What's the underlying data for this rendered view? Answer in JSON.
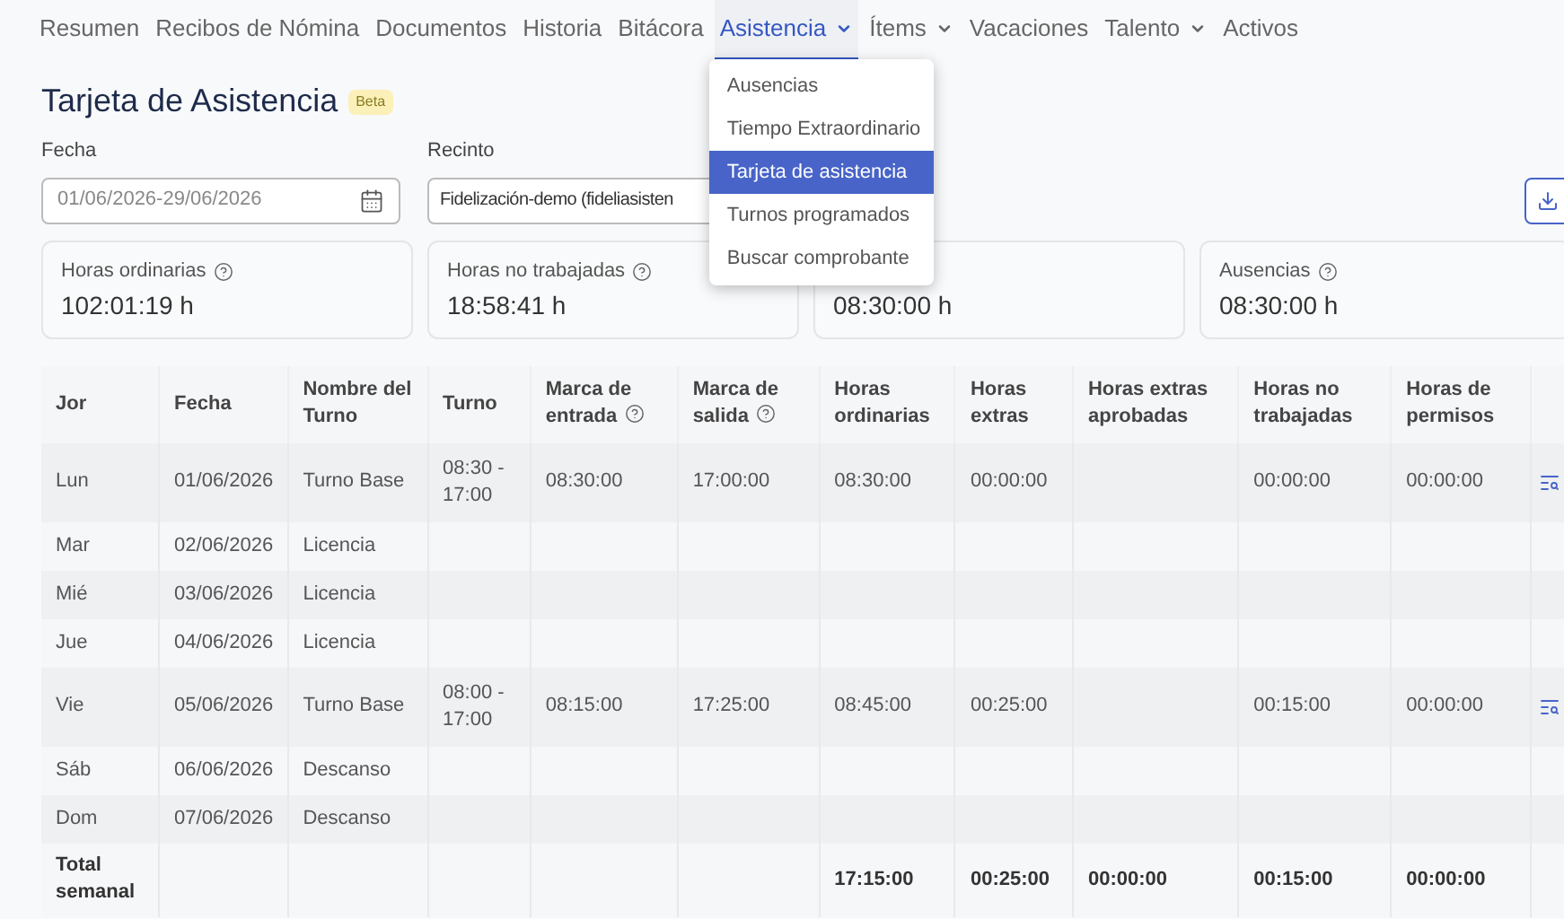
{
  "nav": [
    {
      "label": "Resumen",
      "selected": false,
      "dropdown": false
    },
    {
      "label": "Recibos de Nómina",
      "selected": false,
      "dropdown": false
    },
    {
      "label": "Documentos",
      "selected": false,
      "dropdown": false
    },
    {
      "label": "Historia",
      "selected": false,
      "dropdown": false
    },
    {
      "label": "Bitácora",
      "selected": false,
      "dropdown": false
    },
    {
      "label": "Asistencia",
      "selected": true,
      "dropdown": true,
      "menu": [
        {
          "label": "Ausencias",
          "selected": false
        },
        {
          "label": "Tiempo Extraordinario",
          "selected": false
        },
        {
          "label": "Tarjeta de asistencia",
          "selected": true
        },
        {
          "label": "Turnos programados",
          "selected": false
        },
        {
          "label": "Buscar comprobante",
          "selected": false
        }
      ]
    },
    {
      "label": "Ítems",
      "selected": false,
      "dropdown": true
    },
    {
      "label": "Vacaciones",
      "selected": false,
      "dropdown": false
    },
    {
      "label": "Talento",
      "selected": false,
      "dropdown": true
    },
    {
      "label": "Activos",
      "selected": false,
      "dropdown": false
    }
  ],
  "page": {
    "title": "Tarjeta de Asistencia",
    "badge": "Beta"
  },
  "filters": {
    "date": {
      "label": "Fecha",
      "value": "01/06/2026-29/06/2026"
    },
    "site": {
      "label": "Recinto",
      "value": "Fidelización-demo (fideliasisten"
    }
  },
  "cards": [
    {
      "label": "Horas ordinarias",
      "help": true,
      "value": "102:01:19 h"
    },
    {
      "label": "Horas no trabajadas",
      "help": true,
      "value": "18:58:41 h"
    },
    {
      "help": false,
      "value": "08:30:00 h"
    },
    {
      "label": "Ausencias",
      "help": true,
      "value": "08:30:00 h"
    }
  ],
  "table": {
    "columns": [
      {
        "label": "Jor",
        "help": false
      },
      {
        "label": "Fecha",
        "help": false
      },
      {
        "label": "Nombre del Turno",
        "help": false
      },
      {
        "label": "Turno",
        "help": false
      },
      {
        "label": "Marca de entrada",
        "help": true
      },
      {
        "label": "Marca de salida",
        "help": true
      },
      {
        "label": "Horas ordinarias",
        "help": false
      },
      {
        "label": "Horas extras",
        "help": false
      },
      {
        "label": "Horas extras aprobadas",
        "help": false
      },
      {
        "label": "Horas no trabajadas",
        "help": false
      },
      {
        "label": "Horas de permisos",
        "help": false
      }
    ],
    "rows": [
      {
        "kind": "day",
        "cells": [
          "Lun",
          "01/06/2026",
          "Turno Base",
          "08:30 - 17:00",
          "08:30:00",
          "17:00:00",
          "08:30:00",
          "00:00:00",
          null,
          "00:00:00",
          "00:00:00"
        ],
        "detail": true
      },
      {
        "kind": "day",
        "cells": [
          "Mar",
          "02/06/2026",
          "Licencia"
        ],
        "detail": false
      },
      {
        "kind": "day",
        "cells": [
          "Mié",
          "03/06/2026",
          "Licencia"
        ],
        "detail": false
      },
      {
        "kind": "day",
        "cells": [
          "Jue",
          "04/06/2026",
          "Licencia"
        ],
        "detail": false
      },
      {
        "kind": "day",
        "cells": [
          "Vie",
          "05/06/2026",
          "Turno Base",
          "08:00 - 17:00",
          "08:15:00",
          "17:25:00",
          "08:45:00",
          "00:25:00",
          null,
          "00:15:00",
          "00:00:00"
        ],
        "detail": true
      },
      {
        "kind": "day",
        "cells": [
          "Sáb",
          "06/06/2026",
          "Descanso"
        ],
        "detail": false
      },
      {
        "kind": "day",
        "cells": [
          "Dom",
          "07/06/2026",
          "Descanso"
        ],
        "detail": false
      },
      {
        "kind": "total",
        "cells": [
          "Total semanal",
          null,
          null,
          null,
          null,
          null,
          "17:15:00",
          "00:25:00",
          "00:00:00",
          "00:15:00",
          "00:00:00"
        ],
        "detail": false
      }
    ]
  }
}
